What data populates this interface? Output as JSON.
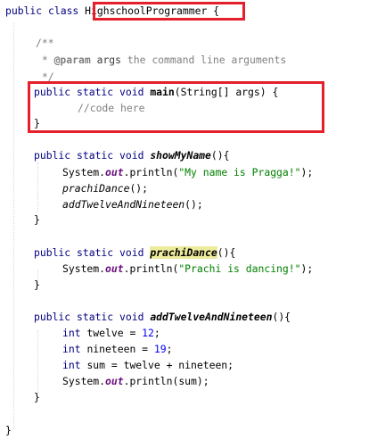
{
  "editor": {
    "language": "java",
    "class_name": "HighschoolProgrammer",
    "colors": {
      "keyword": "#000080",
      "comment": "#808080",
      "string": "#008000",
      "number": "#0000FF",
      "static_field": "#660E7A",
      "usage_highlight": "#EDEB9C",
      "annotation_box": "#E3202C"
    },
    "lines": {
      "class_kw": "public class ",
      "class_name": "HighschoolProgrammer",
      "class_open": " {",
      "doc_open": "/**",
      "doc_star": " * ",
      "doc_tag": "@param",
      "doc_param": " args",
      "doc_text": " the command line arguments",
      "doc_close": " */",
      "main_kw": "public static void ",
      "main_name": "main",
      "main_sig": "(String[] args) {",
      "main_comment": "//code here",
      "close_brace": "}",
      "show_kw": "public static void ",
      "show_name": "showMyName",
      "show_sig": "(){",
      "sys": "System.",
      "out": "out",
      "println_open": ".println(",
      "show_str": "\"My name is Pragga!\"",
      "call_end": ");",
      "call_prachi": "prachiDance",
      "call_paren": "();",
      "call_add": "addTwelveAndNineteen",
      "prachi_kw": "public static void ",
      "prachi_name": "prachiDance",
      "prachi_sig": "(){",
      "prachi_str": "\"Prachi is dancing!\"",
      "add_kw": "public static void ",
      "add_name": "addTwelveAndNineteen",
      "add_sig": "(){",
      "int_kw": "int ",
      "twelve_decl": "twelve = ",
      "twelve_val": "12",
      "nineteen_decl": "nineteen = ",
      "nineteen_val": "19",
      "sum_decl": "sum = twelve + nineteen;",
      "semi": ";",
      "sum_arg": "sum",
      "outer_close": "}"
    }
  }
}
